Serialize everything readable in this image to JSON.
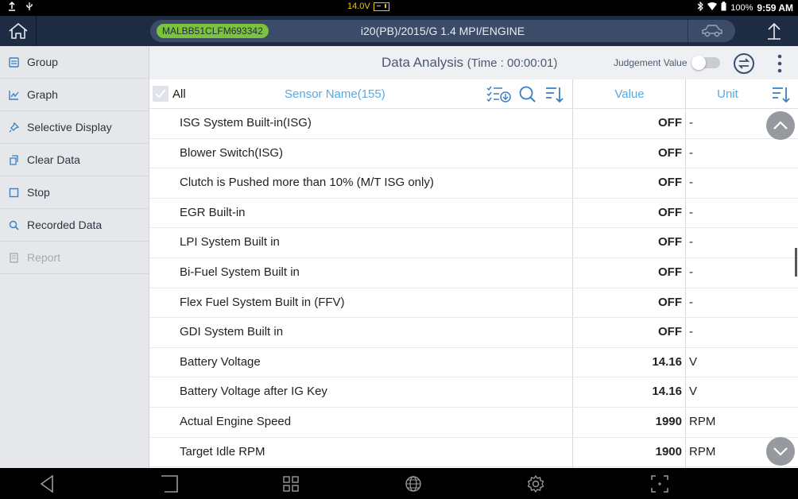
{
  "status_bar": {
    "voltage": "14.0V",
    "battery": "100%",
    "time": "9:59 AM"
  },
  "header": {
    "vin": "MALBB51CLFM693342",
    "vehicle": "i20(PB)/2015/G 1.4 MPI/ENGINE"
  },
  "sidebar": {
    "items": [
      {
        "label": "Group",
        "icon": "group-icon",
        "enabled": true
      },
      {
        "label": "Graph",
        "icon": "graph-icon",
        "enabled": true
      },
      {
        "label": "Selective Display",
        "icon": "pin-icon",
        "enabled": true
      },
      {
        "label": "Clear Data",
        "icon": "clear-icon",
        "enabled": true
      },
      {
        "label": "Stop",
        "icon": "stop-icon",
        "enabled": true
      },
      {
        "label": "Recorded Data",
        "icon": "recorded-icon",
        "enabled": true
      },
      {
        "label": "Report",
        "icon": "report-icon",
        "enabled": false
      }
    ]
  },
  "main": {
    "title": "Data Analysis",
    "time": "(Time : 00:00:01)",
    "judgement_label": "Judgement Value",
    "judgement_on": false
  },
  "table": {
    "all_label": "All",
    "sensor_header": "Sensor Name(155)",
    "value_header": "Value",
    "unit_header": "Unit",
    "rows": [
      {
        "name": "ISG System Built-in(ISG)",
        "value": "OFF",
        "unit": "-"
      },
      {
        "name": "Blower Switch(ISG)",
        "value": "OFF",
        "unit": "-"
      },
      {
        "name": "Clutch is Pushed more than 10% (M/T ISG only)",
        "value": "OFF",
        "unit": "-"
      },
      {
        "name": "EGR Built-in",
        "value": "OFF",
        "unit": "-"
      },
      {
        "name": "LPI System Built in",
        "value": "OFF",
        "unit": "-"
      },
      {
        "name": "Bi-Fuel System Built in",
        "value": "OFF",
        "unit": "-"
      },
      {
        "name": "Flex Fuel System Built in (FFV)",
        "value": "OFF",
        "unit": "-"
      },
      {
        "name": "GDI System Built in",
        "value": "OFF",
        "unit": "-"
      },
      {
        "name": "Battery Voltage",
        "value": "14.16",
        "unit": "V"
      },
      {
        "name": "Battery Voltage after IG Key",
        "value": "14.16",
        "unit": "V"
      },
      {
        "name": "Actual Engine Speed",
        "value": "1990",
        "unit": "RPM"
      },
      {
        "name": "Target Idle RPM",
        "value": "1900",
        "unit": "RPM"
      }
    ]
  },
  "colors": {
    "appbar": "#1d2b43",
    "accent_blue": "#5aa9e0",
    "vin_green": "#7cc23c",
    "voltage_yellow": "#f2c200"
  }
}
